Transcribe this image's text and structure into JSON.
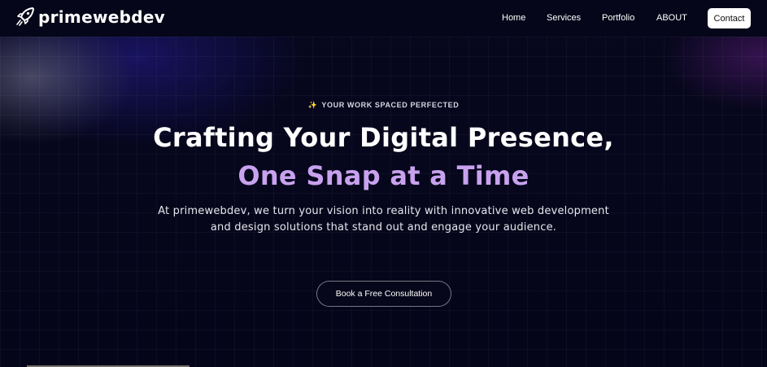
{
  "brand": {
    "name": "primewebdev",
    "logo_icon": "rocket-icon"
  },
  "nav": {
    "links": [
      "Home",
      "Services",
      "Portfolio",
      "ABOUT"
    ],
    "contact_label": "Contact"
  },
  "hero": {
    "tagline_icon": "sparkle-icon",
    "tagline": "YOUR WORK SPACED PERFECTED",
    "headline_line1": "Crafting Your Digital Presence,",
    "headline_line2": "One Snap at a Time",
    "description_line1": "At primewebdev, we turn your vision into reality with innovative web development",
    "description_line2": "and design solutions that stand out and engage your audience.",
    "cta_label": "Book a Free Consultation"
  },
  "colors": {
    "background": "#05051a",
    "accent_headline": "#c8a2ee",
    "button_bg": "#ffffff"
  }
}
